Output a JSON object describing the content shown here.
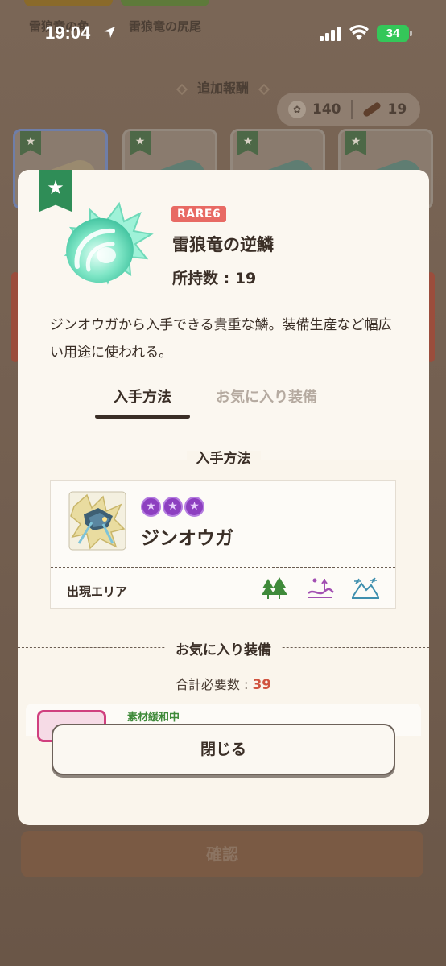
{
  "status_bar": {
    "time": "19:04",
    "battery": "34"
  },
  "background": {
    "materials": [
      "雷狼竜の角",
      "雷狼竜の尻尾"
    ],
    "section_title": "追加報酬",
    "counter_paw": "140",
    "counter_claw": "19",
    "confirm_label": "確認"
  },
  "modal": {
    "rarity": "RARE6",
    "item_name": "雷狼竜の逆鱗",
    "owned": "所持数 : 19",
    "description": "ジンオウガから入手できる貴重な鱗。装備生産など幅広い用途に使われる。",
    "tabs": [
      {
        "label": "入手方法",
        "active": true
      },
      {
        "label": "お気に入り装備",
        "active": false
      }
    ],
    "source_section_title": "入手方法",
    "source": {
      "monster_name": "ジンオウガ",
      "stars": 3,
      "area_label": "出現エリア",
      "areas": [
        "forest-icon",
        "swamp-icon",
        "snow-mountain-icon"
      ]
    },
    "favorites_section_title": "お気に入り装備",
    "total_label": "合計必要数 : ",
    "total_value": "39",
    "favorite_status": "素材緩和中",
    "close_label": "閉じる"
  },
  "colors": {
    "accent_green": "#2f8d57",
    "rare_red": "#e86a64",
    "star_purple": "#8d3fc0",
    "total_red": "#d0533f"
  }
}
